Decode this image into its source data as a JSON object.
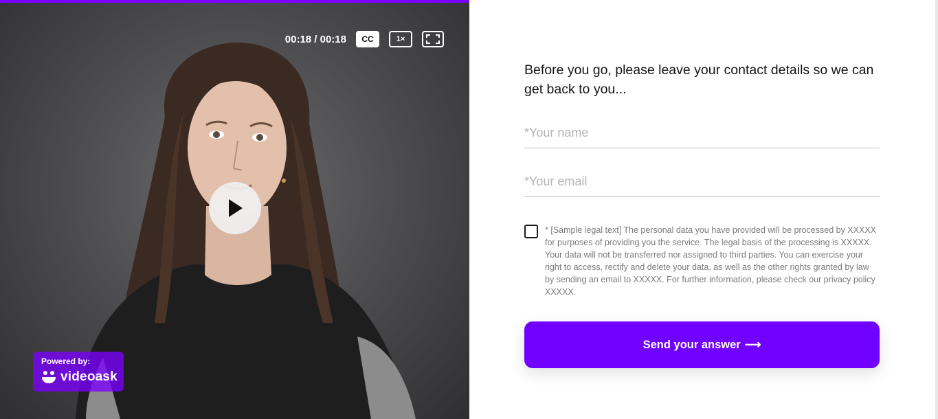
{
  "video": {
    "time_display": "00:18 / 00:18",
    "progress_fraction": 1.0,
    "cc_label": "CC",
    "speed_label": "1×",
    "accent_color": "#7b00ff",
    "icons": {
      "play": "play-icon",
      "fullscreen": "fullscreen-icon",
      "brand": "videoask-smile-icon"
    },
    "branding": {
      "prefix": "Powered by:",
      "name": "videoask"
    }
  },
  "form": {
    "question": "Before you go, please leave your contact details so we can get back to you...",
    "name_placeholder": "*Your name",
    "name_value": "",
    "email_placeholder": "*Your email",
    "email_value": "",
    "consent_checked": false,
    "legal_text": "* [Sample legal text] The personal data you have provided will be processed by XXXXX for purposes of providing you the service. The legal basis of the processing is XXXXX. Your data will not be transferred nor assigned to third parties. You can exercise your right to access, rectify and delete your data, as well as the other rights granted by law by sending an email to XXXXX. For further information, please check our privacy policy XXXXX.",
    "submit_label": "Send your answer",
    "submit_arrow": "⟶",
    "submit_color": "#7000ff"
  }
}
